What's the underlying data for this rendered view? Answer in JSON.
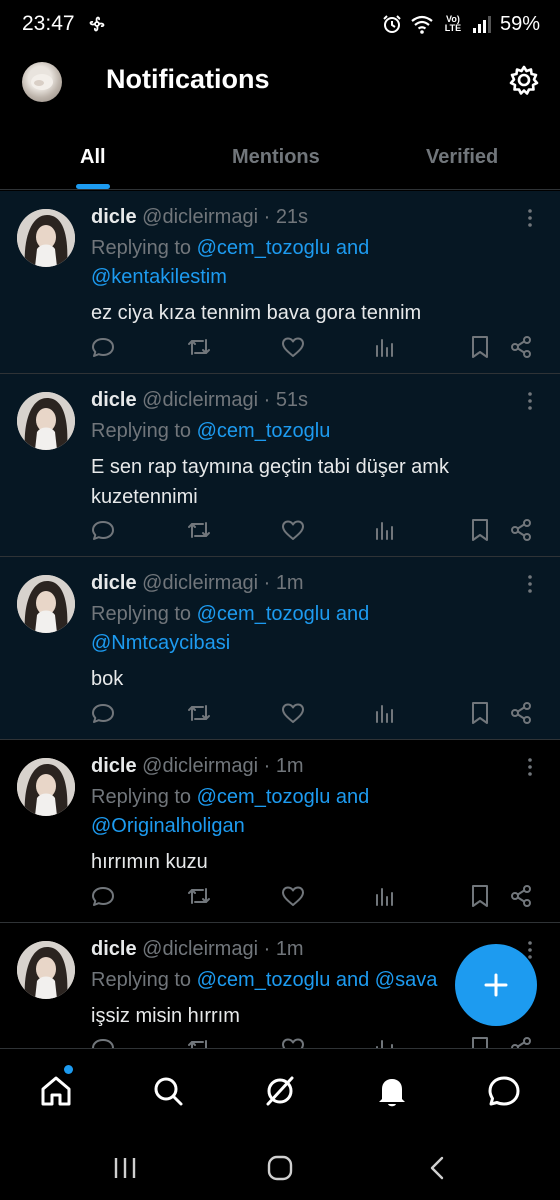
{
  "status_bar": {
    "time": "23:47",
    "battery": "59%",
    "network_label": "Vo) LTE"
  },
  "header": {
    "title": "Notifications",
    "avatar_icon": "profile-avatar",
    "settings_icon": "gear-icon"
  },
  "tabs": [
    {
      "label": "All",
      "active": true
    },
    {
      "label": "Mentions",
      "active": false
    },
    {
      "label": "Verified",
      "active": false
    }
  ],
  "posts": [
    {
      "name": "dicle",
      "handle": "@dicleirmagi",
      "time": "21s",
      "replying_prefix": "Replying to ",
      "replying_to_1": "@cem_tozoglu and",
      "replying_to_2": "@kentakilestim",
      "text": "ez ciya kıza tennim bava gora tennim"
    },
    {
      "name": "dicle",
      "handle": "@dicleirmagi",
      "time": "51s",
      "replying_prefix": "Replying to ",
      "replying_to_1": "@cem_tozoglu",
      "replying_to_2": "",
      "text": "E sen rap taymına geçtin tabi düşer amk kuzetennimi"
    },
    {
      "name": "dicle",
      "handle": "@dicleirmagi",
      "time": "1m",
      "replying_prefix": "Replying to ",
      "replying_to_1": "@cem_tozoglu and",
      "replying_to_2": "@Nmtcaycibasi",
      "text": "bok"
    },
    {
      "name": "dicle",
      "handle": "@dicleirmagi",
      "time": "1m",
      "replying_prefix": "Replying to ",
      "replying_to_1": "@cem_tozoglu and",
      "replying_to_2": "@Originalholigan",
      "text": "hırrımın kuzu"
    },
    {
      "name": "dicle",
      "handle": "@dicleirmagi",
      "time": "1m",
      "replying_prefix": "Replying to ",
      "replying_to_1": "@cem_tozoglu and @sava",
      "replying_to_2": "",
      "text": "işsiz misin hırrım"
    }
  ],
  "dot_separator": " · ",
  "colors": {
    "accent": "#1d9bf0",
    "unread_bg": "#061723",
    "muted": "#71767b",
    "text": "#e7e9ea"
  },
  "bottom_nav": [
    "home-icon",
    "search-icon",
    "grok-icon",
    "notifications-icon",
    "messages-icon"
  ],
  "fab": "compose-plus-icon"
}
